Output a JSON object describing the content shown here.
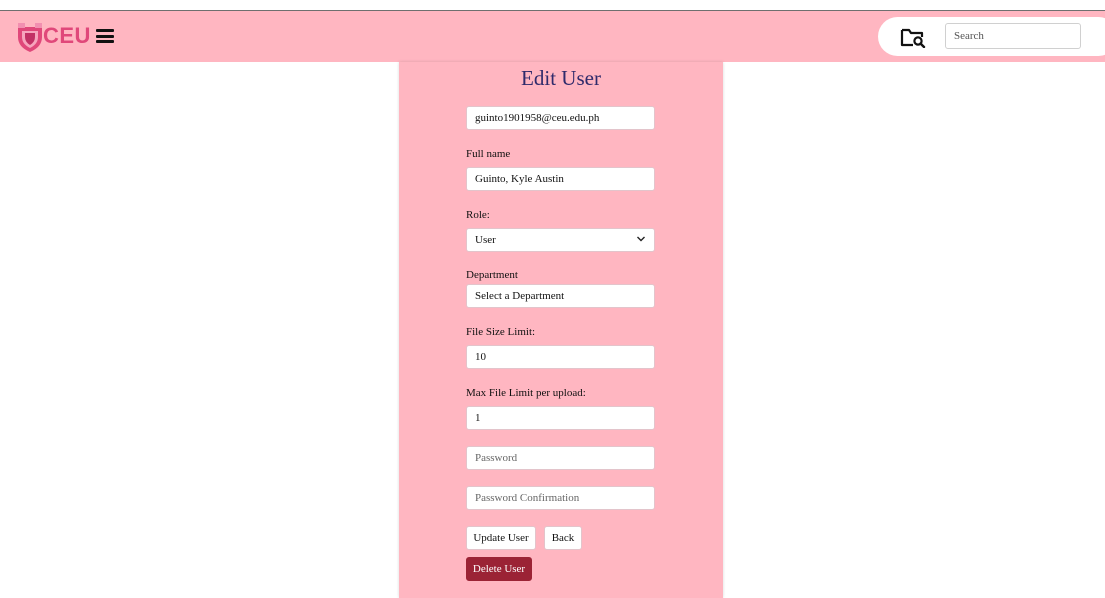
{
  "navbar": {
    "logo_text": "CEU",
    "menu_icon": "hamburger-menu-icon",
    "folder_icon": "folder-search-icon",
    "search_placeholder": "Search",
    "background": "#ffb6c1"
  },
  "form": {
    "title": "Edit User",
    "email_value": "guinto1901958@ceu.edu.ph",
    "full_name_label": "Full name",
    "full_name_value": "Guinto, Kyle Austin",
    "role_label": "Role:",
    "role_value": "User",
    "department_label": "Department",
    "department_value": "Select a Department",
    "file_size_label": "File Size Limit:",
    "file_size_value": "10",
    "max_file_label": "Max File Limit per upload:",
    "max_file_value": "1",
    "password_placeholder": "Password",
    "password_confirm_placeholder": "Password Confirmation",
    "update_button": "Update User",
    "back_button": "Back",
    "delete_button": "Delete User"
  },
  "colors": {
    "panel": "#ffb6c1",
    "title": "#2f2a6b",
    "delete": "#9b2335",
    "logo": "#e0487a"
  }
}
